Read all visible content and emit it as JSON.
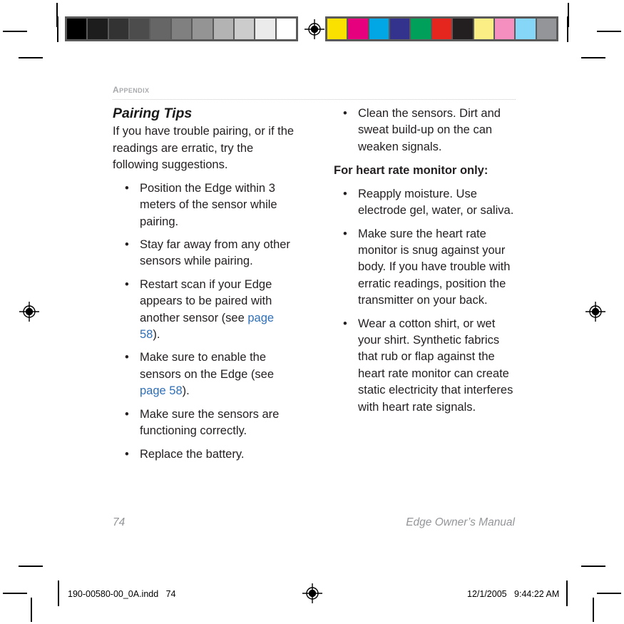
{
  "page": {
    "section_label": "Appendix",
    "page_number": "74",
    "manual_title": "Edge Owner’s Manual"
  },
  "left_column": {
    "heading": "Pairing Tips",
    "intro": "If you have trouble pairing, or if the readings are erratic, try the following suggestions.",
    "bullet_char": "•",
    "bullets": [
      {
        "parts": [
          {
            "text": "Position the Edge within 3 meters of the sensor while pairing.",
            "type": "plain"
          }
        ]
      },
      {
        "parts": [
          {
            "text": "Stay far away from any other sensors while pairing.",
            "type": "plain"
          }
        ]
      },
      {
        "parts": [
          {
            "text": "Restart scan if your Edge appears to be paired with another sensor (see ",
            "type": "plain"
          },
          {
            "text": "page 58",
            "type": "xref"
          },
          {
            "text": ").",
            "type": "plain"
          }
        ]
      },
      {
        "parts": [
          {
            "text": "Make sure to enable the sensors on the Edge (see ",
            "type": "plain"
          },
          {
            "text": "page 58",
            "type": "xref"
          },
          {
            "text": ").",
            "type": "plain"
          }
        ]
      },
      {
        "parts": [
          {
            "text": "Make sure the sensors are functioning correctly.",
            "type": "plain"
          }
        ]
      },
      {
        "parts": [
          {
            "text": "Replace the battery.",
            "type": "plain"
          }
        ]
      }
    ]
  },
  "right_column": {
    "bullet_char": "•",
    "top_bullets": [
      {
        "parts": [
          {
            "text": "Clean the sensors. Dirt and sweat build-up on the can weaken signals.",
            "type": "plain"
          }
        ]
      }
    ],
    "subheading": "For heart rate monitor only:",
    "bullets": [
      {
        "parts": [
          {
            "text": "Reapply moisture. Use electrode gel, water, or saliva.",
            "type": "plain"
          }
        ]
      },
      {
        "parts": [
          {
            "text": "Make sure the heart rate monitor is snug against your body. If you have trouble with erratic readings, position the transmitter on your back.",
            "type": "plain"
          }
        ]
      },
      {
        "parts": [
          {
            "text": "Wear a cotton shirt, or wet your shirt. Synthetic fabrics that rub or flap against the heart rate monitor can create static electricity that interferes with heart rate signals.",
            "type": "plain"
          }
        ]
      }
    ]
  },
  "prepress": {
    "slug_left": "190-00580-00_0A.indd   74",
    "slug_right": "12/1/2005   9:44:22 AM",
    "grayscale_bar": {
      "label": "grayscale-control-bar",
      "swatches": [
        "#000000",
        "#1d1d1d",
        "#333333",
        "#4c4c4c",
        "#666666",
        "#808080",
        "#949494",
        "#b3b3b3",
        "#cccccc",
        "#ebebeb",
        "#ffffff"
      ]
    },
    "color_bar": {
      "label": "color-control-bar",
      "swatches": [
        "#fae100",
        "#e6007e",
        "#00a7e4",
        "#33338e",
        "#00a05a",
        "#e5261e",
        "#231f20",
        "#fbee84",
        "#f48fc0",
        "#85d6f7",
        "#939598"
      ]
    }
  }
}
